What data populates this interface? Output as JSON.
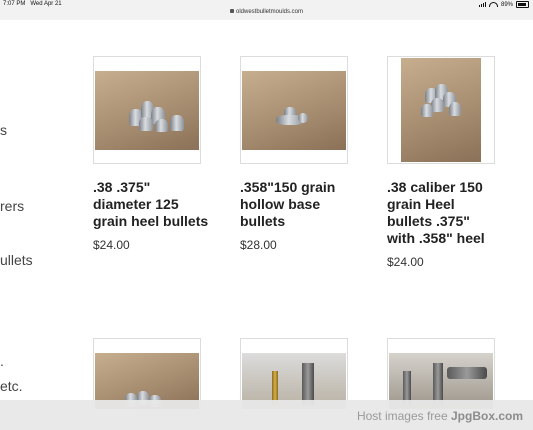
{
  "status_bar": {
    "time": "7:07 PM",
    "date": "Wed Apr 21",
    "url": "oldwestbulletmoulds.com",
    "battery": "89%"
  },
  "sidebar_fragments": [
    "s",
    "rers",
    "ullets",
    ".",
    "etc."
  ],
  "products": [
    {
      "title_lines": [
        ".38 .375\"",
        "diameter 125",
        "grain heel bullets"
      ],
      "price": "$24.00"
    },
    {
      "title_lines": [
        ".358\"150 grain",
        "hollow base",
        "bullets"
      ],
      "price": "$28.00"
    },
    {
      "title_lines": [
        ".38 caliber 150",
        "grain Heel",
        "bullets .375\"",
        "with .358\" heel"
      ],
      "price": "$24.00"
    }
  ],
  "footer": {
    "prefix": "Host images free ",
    "brand": "JpgBox.com"
  }
}
